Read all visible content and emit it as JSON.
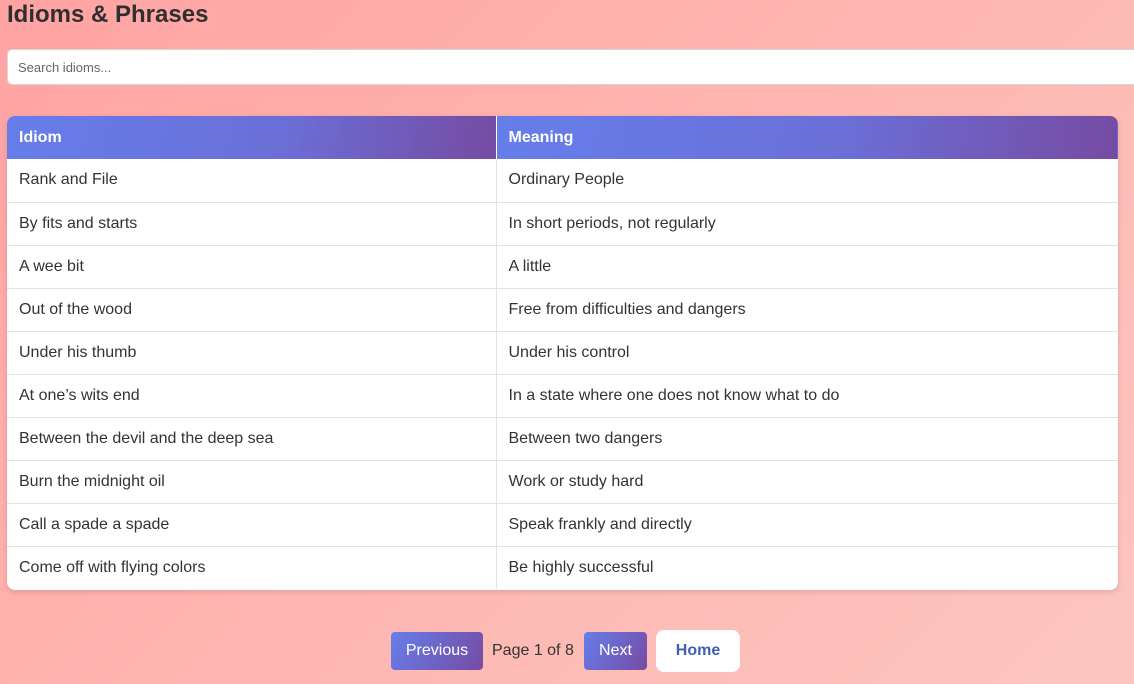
{
  "page": {
    "title": "Idioms & Phrases"
  },
  "search": {
    "placeholder": "Search idioms...",
    "value": ""
  },
  "table": {
    "headers": {
      "idiom": "Idiom",
      "meaning": "Meaning"
    },
    "rows": [
      {
        "idiom": "Rank and File",
        "meaning": "Ordinary People"
      },
      {
        "idiom": "By fits and starts",
        "meaning": "In short periods, not regularly"
      },
      {
        "idiom": "A wee bit",
        "meaning": "A little"
      },
      {
        "idiom": "Out of the wood",
        "meaning": "Free from difficulties and dangers"
      },
      {
        "idiom": "Under his thumb",
        "meaning": "Under his control"
      },
      {
        "idiom": "At one’s wits end",
        "meaning": "In a state where one does not know what to do"
      },
      {
        "idiom": "Between the devil and the deep sea",
        "meaning": "Between two dangers"
      },
      {
        "idiom": "Burn the midnight oil",
        "meaning": "Work or study hard"
      },
      {
        "idiom": "Call a spade a spade",
        "meaning": "Speak frankly and directly"
      },
      {
        "idiom": "Come off with flying colors",
        "meaning": "Be highly successful"
      }
    ]
  },
  "pagination": {
    "previous_label": "Previous",
    "page_info": "Page 1 of 8",
    "next_label": "Next",
    "home_label": "Home"
  },
  "colors": {
    "accent_start": "#667eea",
    "accent_end": "#764ba2",
    "background_start": "#ffa3a3",
    "background_end": "#fcc6bf",
    "home_text": "#3f5fb5"
  }
}
